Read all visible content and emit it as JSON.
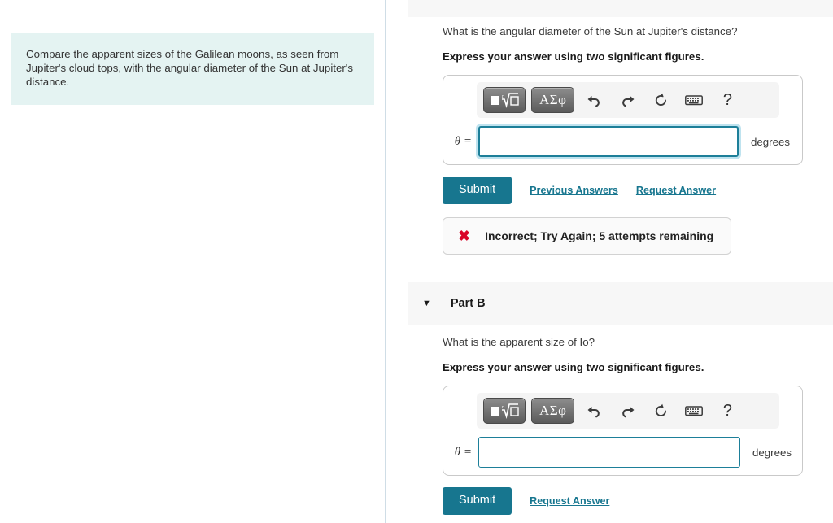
{
  "left_panel": {
    "instruction": "Compare the apparent sizes of the Galilean moons, as seen from Jupiter's cloud tops, with the angular diameter of the Sun at Jupiter's distance."
  },
  "math_toolbar": {
    "sqrt_button_label": "■ⁿ√□",
    "greek_button_label": "ΑΣφ",
    "undo_label": "↰",
    "redo_label": "↱",
    "reset_label": "↻",
    "keyboard_label": "⌨",
    "help_label": "?",
    "icons": [
      "square-root-icon",
      "greek-letters-icon",
      "undo-icon",
      "redo-icon",
      "reset-icon",
      "keyboard-icon",
      "help-icon"
    ]
  },
  "part_a": {
    "question": "What is the angular diameter of the Sun at Jupiter's distance?",
    "instruction": "Express your answer using two significant figures.",
    "variable_label": "θ =",
    "answer_value": "",
    "answer_placeholder": "",
    "unit": "degrees",
    "submit_label": "Submit",
    "previous_answers_label": "Previous Answers",
    "request_answer_label": "Request Answer",
    "feedback": {
      "icon": "✖",
      "text": "Incorrect; Try Again; 5 attempts remaining"
    }
  },
  "part_b": {
    "header_label": "Part B",
    "caret": "▼",
    "question": "What is the apparent size of Io?",
    "instruction": "Express your answer using two significant figures.",
    "variable_label": "θ =",
    "answer_value": "",
    "answer_placeholder": "",
    "unit": "degrees",
    "submit_label": "Submit",
    "request_answer_label": "Request Answer"
  },
  "colors": {
    "accent_teal": "#17768f",
    "input_border": "#1d7f99",
    "instruction_bg": "#e4f3f2",
    "band_bg": "#f7f7f7",
    "error_red": "#d90429"
  }
}
